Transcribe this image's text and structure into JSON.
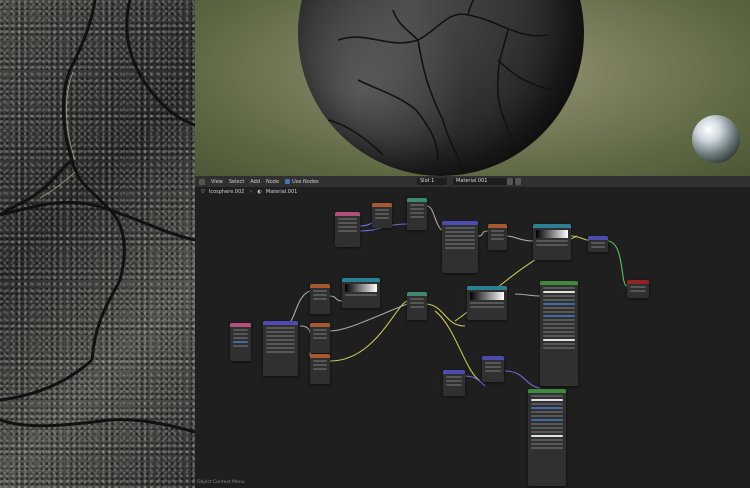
{
  "node_editor": {
    "menu": [
      "View",
      "Select",
      "Add",
      "Node"
    ],
    "use_nodes_label": "Use Nodes",
    "slot_label": "Slot 1",
    "material_name": "Material.001",
    "breadcrumb": [
      "Icosphere.002",
      "Material.001"
    ],
    "status_text": "Object Context Menu"
  },
  "colors": {
    "header_bg": "#303030",
    "editor_bg": "#1f1f1f",
    "accent": "#4772b3",
    "wire_yellow": "#c7c75a",
    "wire_grey": "#a8a8a8",
    "wire_purple": "#6b6bd6",
    "wire_green": "#5fbf5f"
  },
  "icons": [
    "checkbox-icon",
    "material-icon",
    "pin-icon",
    "mesh-icon",
    "shader-icon"
  ]
}
